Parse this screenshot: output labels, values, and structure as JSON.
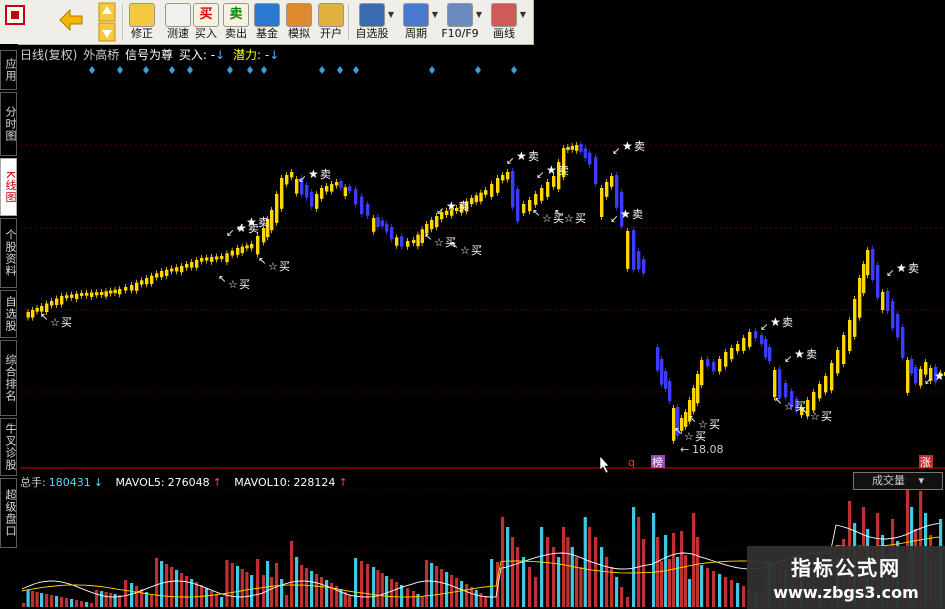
{
  "toolbar": {
    "buttons": [
      {
        "label": "修正",
        "icon": "bookmark-icon"
      },
      {
        "label": "测速",
        "icon": "clock-icon"
      },
      {
        "label": "买入",
        "icon": "buy-icon"
      },
      {
        "label": "卖出",
        "icon": "sell-icon"
      },
      {
        "label": "基金",
        "icon": "fund-icon"
      },
      {
        "label": "模拟",
        "icon": "gavel-icon"
      },
      {
        "label": "开户",
        "icon": "lock-icon"
      },
      {
        "label": "自选股",
        "icon": "star-icon"
      },
      {
        "label": "周期",
        "icon": "period-icon"
      },
      {
        "label": "F10/F9",
        "icon": "f10-icon"
      },
      {
        "label": "画线",
        "icon": "pencil-icon"
      }
    ]
  },
  "sidebar": {
    "tabs": [
      "应用",
      "分时图",
      "K线图",
      "个股资料",
      "自选股",
      "综合排名",
      "牛叉诊股",
      "超级盘口"
    ]
  },
  "indicator_line": {
    "kline_type": "日线(复权)",
    "stock_name": "外高桥",
    "signal_text": "信号为尊",
    "buy_label": "买入:",
    "buy_value": "-",
    "potential_label": "潜力:",
    "potential_value": "-"
  },
  "chart_labels": {
    "buy": "买",
    "sell": "卖",
    "low_price": "18.08",
    "q_marker": "q",
    "rank_marker": "榜",
    "zhang_marker": "涨"
  },
  "volume": {
    "total_label": "总手:",
    "total_value": "180431",
    "mavol5_label": "MAVOL5:",
    "mavol5_value": "276048",
    "mavol10_label": "MAVOL10:",
    "mavol10_value": "228124",
    "selector_label": "成交量"
  },
  "watermark": {
    "title": "指标公式网",
    "url": "www.zbgs3.com"
  },
  "colors": {
    "up_candle": "#ffd700",
    "down_candle": "#3c3cff",
    "volume_up": "#c03030",
    "volume_down": "#40c8e0",
    "grid": "#7a0000",
    "annotation": "#ffffff"
  }
}
